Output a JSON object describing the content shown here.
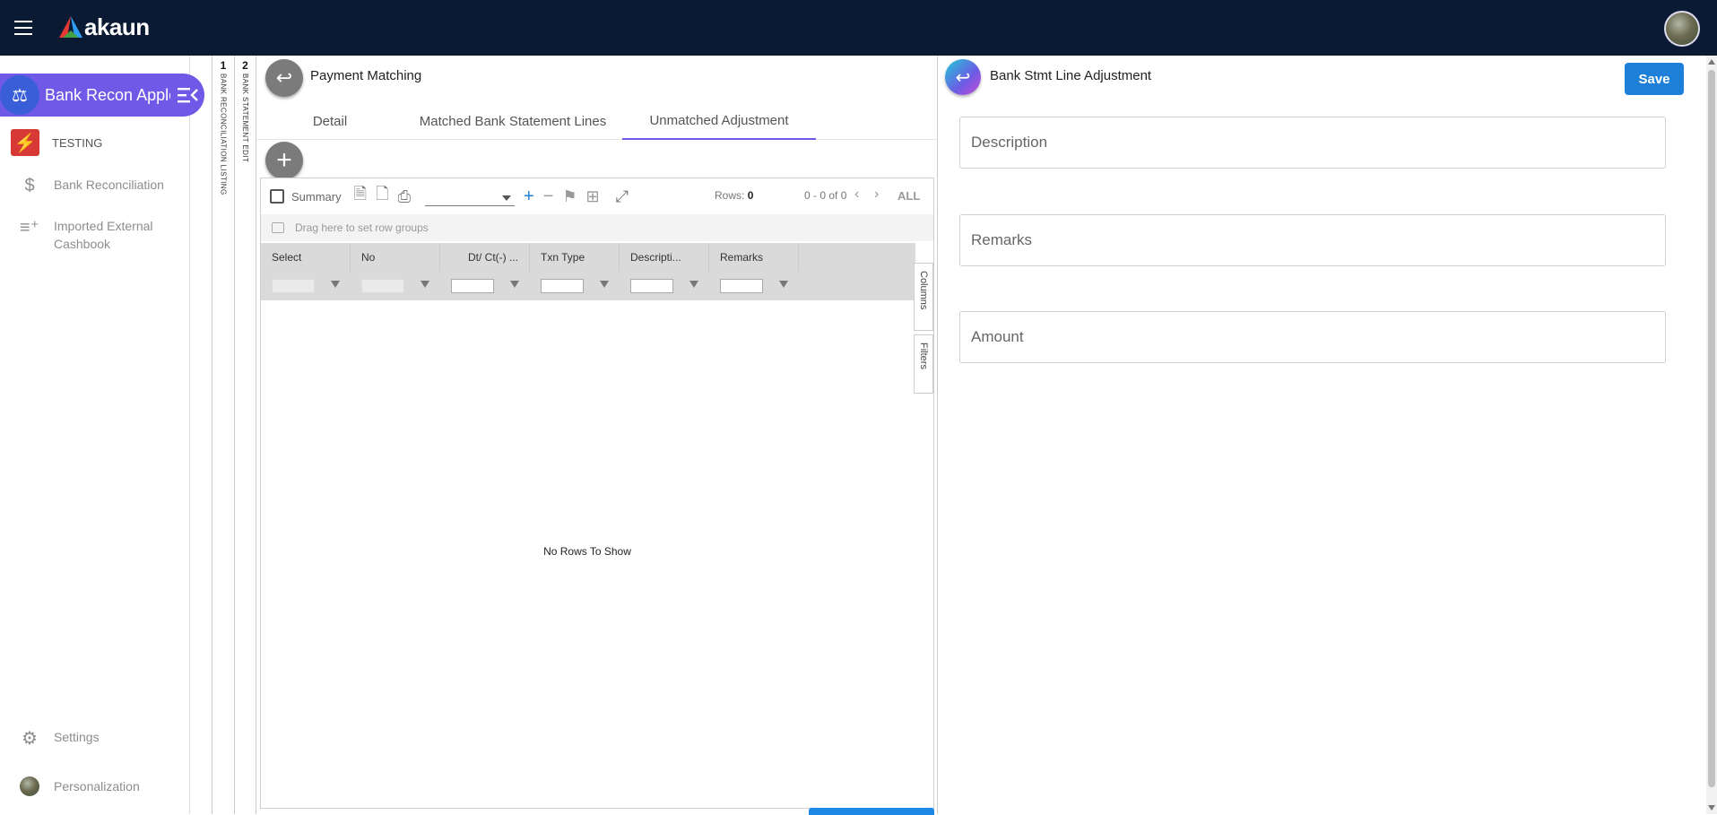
{
  "app": {
    "logo_text": "akaun"
  },
  "sidebar": {
    "app_name": "Bank Recon Apple",
    "items": [
      {
        "label": "TESTING",
        "icon": "testing-app-icon"
      },
      {
        "label": "Bank Reconciliation",
        "icon": "dollar-icon"
      },
      {
        "label": "Imported External Cashbook",
        "icon": "playlist-add-icon"
      }
    ],
    "bottom": [
      {
        "label": "Settings",
        "icon": "gear-icon"
      },
      {
        "label": "Personalization",
        "icon": "avatar"
      }
    ]
  },
  "vtabs": [
    {
      "num": "1",
      "label": "BANK RECONCILIATION LISTING"
    },
    {
      "num": "2",
      "label": "BANK STATEMENT EDIT"
    }
  ],
  "payment": {
    "title": "Payment Matching",
    "tabs": [
      "Detail",
      "Matched Bank Statement Lines",
      "Unmatched Adjustment"
    ],
    "active_tab": "Unmatched Adjustment",
    "toolbar": {
      "summary": "Summary",
      "rows_label": "Rows:",
      "rows_value": "0",
      "paging": "0 - 0 of 0",
      "all": "ALL"
    },
    "group_hint": "Drag here to set row groups",
    "columns": [
      "Select",
      "No",
      "Dt/ Ct(-) ...",
      "Txn Type",
      "Descripti...",
      "Remarks"
    ],
    "side_tabs": [
      "Columns",
      "Filters"
    ],
    "empty": "No Rows To Show"
  },
  "adjust": {
    "title": "Bank Stmt Line Adjustment",
    "save": "Save",
    "fields": [
      "Description",
      "Remarks",
      "Amount"
    ]
  },
  "colors": {
    "topbar": "#0b1a33",
    "accent": "#6f59e6",
    "save": "#1e7fd8"
  }
}
